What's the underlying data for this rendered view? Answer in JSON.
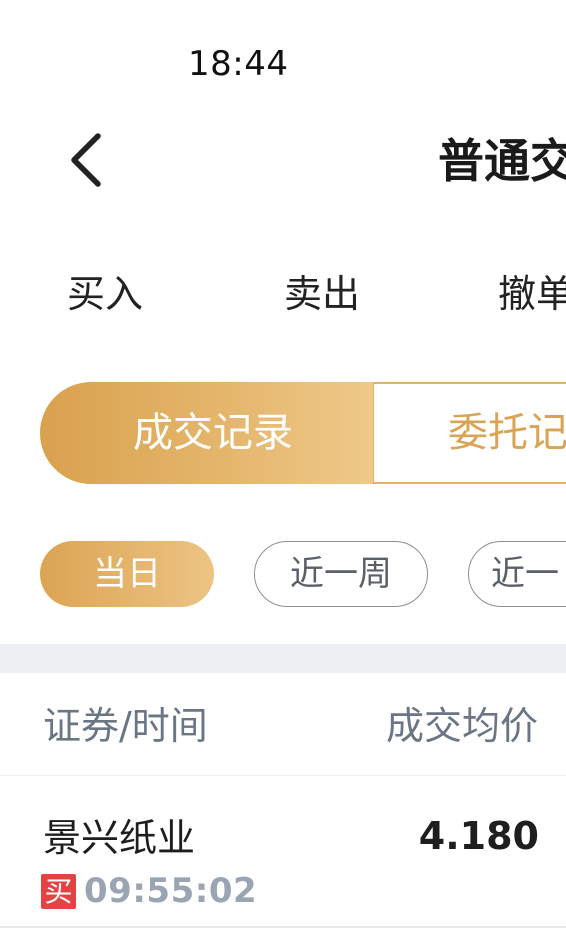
{
  "status_bar": {
    "time": "18:44"
  },
  "header": {
    "title": "普通交"
  },
  "trade_tabs": [
    {
      "label": "买入"
    },
    {
      "label": "卖出"
    },
    {
      "label": "撤单"
    }
  ],
  "record_tabs": {
    "active": "成交记录",
    "inactive": "委托记"
  },
  "time_filters": [
    {
      "label": "当日",
      "active": true
    },
    {
      "label": "近一周",
      "active": false
    },
    {
      "label": "近一",
      "active": false
    }
  ],
  "table": {
    "headers": {
      "left": "证券/时间",
      "right": "成交均价"
    },
    "rows": [
      {
        "name": "景兴纸业",
        "side": "买",
        "time": "09:55:02",
        "price": "4.180"
      }
    ]
  },
  "colors": {
    "accent_gold": "#d9a14e",
    "accent_gold_light": "#efc98a",
    "buy_red": "#e54343",
    "muted_gray": "#9aa4b2"
  }
}
